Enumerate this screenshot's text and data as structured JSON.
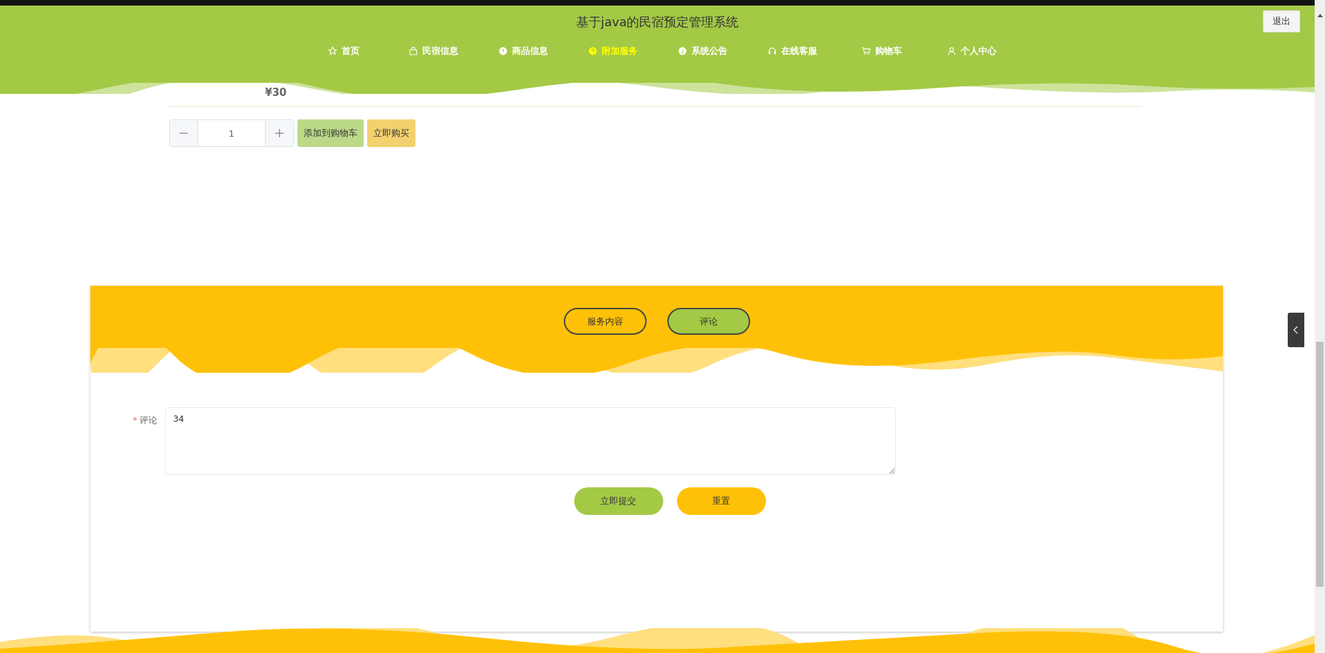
{
  "header": {
    "title": "基于java的民宿预定管理系统",
    "logout": "退出",
    "nav": [
      {
        "label": "首页",
        "selected": false
      },
      {
        "label": "民宿信息",
        "selected": false
      },
      {
        "label": "商品信息",
        "selected": false
      },
      {
        "label": "附加服务",
        "selected": true
      },
      {
        "label": "系统公告",
        "selected": false
      },
      {
        "label": "在线客服",
        "selected": false
      },
      {
        "label": "购物车",
        "selected": false
      },
      {
        "label": "个人中心",
        "selected": false
      }
    ]
  },
  "product": {
    "price": "¥30",
    "quantity": "1",
    "buttons": [
      "添加到购物车",
      "立即购买"
    ]
  },
  "card": {
    "tabs": [
      {
        "label": "服务内容",
        "selected": false
      },
      {
        "label": "评论",
        "selected": true
      }
    ],
    "form": {
      "label": "评论",
      "required_mark": "*",
      "value": "34"
    },
    "buttons": [
      "立即提交",
      "重置"
    ]
  }
}
